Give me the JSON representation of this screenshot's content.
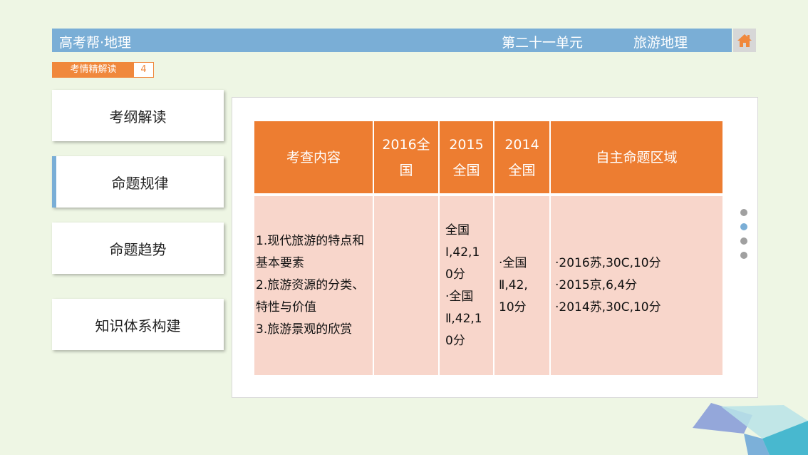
{
  "header": {
    "brand": "高考帮·地理",
    "unit": "第二十一单元",
    "topic": "旅游地理",
    "home_icon": "home-icon",
    "bar_color": "#7aaed6"
  },
  "subtag": {
    "label": "考情精解读",
    "page": "4"
  },
  "nav": [
    {
      "label": "考纲解读"
    },
    {
      "label": "命题规律"
    },
    {
      "label": "命题趋势"
    },
    {
      "label": "知识体系构建"
    }
  ],
  "active_nav": "命题规律",
  "table": {
    "headers": [
      [
        "考查内容"
      ],
      [
        "2016全",
        "国"
      ],
      [
        "2015",
        "全国"
      ],
      [
        "2014",
        "全国"
      ],
      [
        "自主命题区域"
      ]
    ],
    "row": {
      "content": [
        "1.现代旅游的特点和",
        "基本要素",
        "2.旅游资源的分类、",
        "特性与价值",
        "3.旅游景观的欣赏"
      ],
      "y2016": [],
      "y2015": [
        "全国",
        "Ⅰ,42,1",
        "0分",
        "·全国",
        "Ⅱ,42,1",
        "0分"
      ],
      "y2014": [
        "·全国",
        "Ⅱ,42,",
        "10分"
      ],
      "regional": [
        "·2016苏,30C,10分",
        "·2015京,6,4分",
        "·2014苏,30C,10分"
      ]
    },
    "header_color": "#ed7d31",
    "cell_color": "#f8d6cb"
  },
  "pager": {
    "total": 4,
    "active_index": 1
  }
}
